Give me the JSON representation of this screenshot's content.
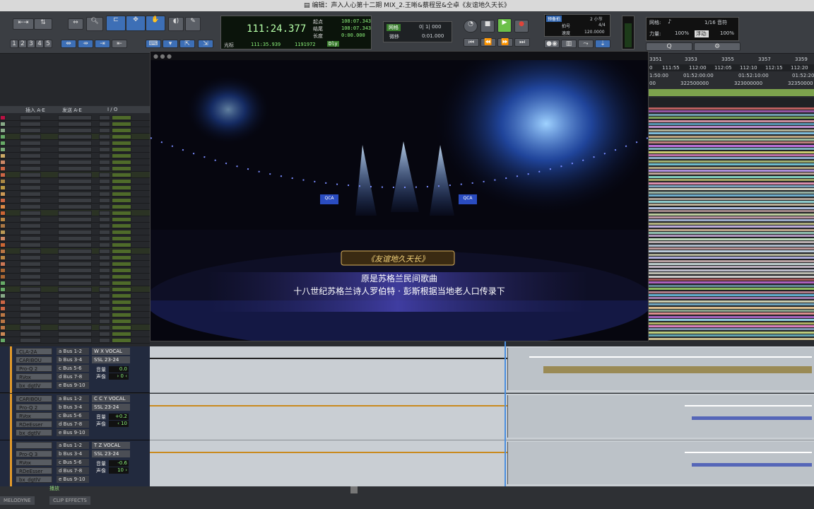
{
  "window": {
    "title": "编辑：声入人心第十二期 MIX_2.王晰&蔡程昱&仝卓《友谊地久天长》"
  },
  "toolbar": {
    "counter": {
      "main": "111:24.377",
      "start_label": "起点",
      "start_value": "108:07.343",
      "end_label": "结尾",
      "end_value": "108:07.343",
      "length_label": "长度",
      "length_value": "0:00.000",
      "cursor_label": "光标",
      "cursor_value": "111:35.939",
      "cursor_samples": "1191972",
      "dly": "Dly"
    },
    "numbers": [
      "1",
      "2",
      "3",
      "4",
      "5"
    ],
    "grid": {
      "label": "网格",
      "value": "0| 1| 000",
      "nudge_label": "微移",
      "nudge_value": "0:01.000"
    },
    "meter": {
      "preroll": "预备拍",
      "bars": "2 小节",
      "beat_label": "拍号",
      "beat_value": "4/4",
      "tempo_label": "速度",
      "tempo_value": "120.0000"
    },
    "grid2": {
      "label": "网格:",
      "value": "1/16 音符",
      "velocity_label": "力量:",
      "velocity_value": "100%",
      "float_label": "浮动:",
      "float_value": "100%"
    }
  },
  "ruler": {
    "bars": [
      "3351",
      "3353",
      "3355",
      "3357",
      "3359"
    ],
    "times": [
      "112:00",
      "112:05",
      "112:10",
      "112:15",
      "112:20"
    ],
    "times_prefix": [
      "0",
      "111:55"
    ],
    "min": [
      "1:50:00",
      "01:52:00:00",
      "01:52:10:00",
      "01:52:20"
    ],
    "samples": [
      "00",
      "322500000",
      "323000000",
      "32350000"
    ],
    "marker": "B 1"
  },
  "mix_header": {
    "inserts": "插入 A-E",
    "sends": "发送 A-E",
    "io": "I / O"
  },
  "video_overlay": {
    "badge_left": "QCA",
    "badge_right": "QCA",
    "title_plate": "《友谊地久天长》",
    "sub1": "原是苏格兰民间歌曲",
    "sub2": "十八世纪苏格兰诗人罗伯特 · 彭斯根据当地老人口传录下"
  },
  "tracks": [
    {
      "plugins": [
        "CLA-2A",
        "CARIBOU",
        "Pro-Q 2",
        "RVox",
        "bx_dgtlV"
      ],
      "buses": [
        "a  Bus 1-2",
        "b  Bus 3-4",
        "c  Bus 5-6",
        "d  Bus 7-8",
        "e  Bus 9-10"
      ],
      "name": "W X VOCAL",
      "out": "SSL 23-24",
      "vol_label": "音量",
      "vol": "0.0",
      "pan_label": "声像",
      "pan": "› 0 ‹"
    },
    {
      "plugins": [
        "CARIBOU",
        "Pro-Q 2",
        "RVox",
        "RDeEsser",
        "bx_dgtlV"
      ],
      "buses": [
        "a  Bus 1-2",
        "b  Bus 3-4",
        "c  Bus 5-6",
        "d  Bus 7-8",
        "e  Bus 9-10"
      ],
      "name": "C C Y VOCAL",
      "out": "SSL 23-24",
      "vol_label": "音量",
      "vol": "+0.2",
      "pan_label": "声像",
      "pan": "‹ 10"
    },
    {
      "plugins": [
        "",
        "Pro-Q 3",
        "RVox",
        "RDeEsser",
        "bx_dgtlV"
      ],
      "buses": [
        "a  Bus 1-2",
        "b  Bus 3-4",
        "c  Bus 5-6",
        "d  Bus 7-8",
        "e  Bus 9-10"
      ],
      "name": "T Z VOCAL",
      "out": "SSL 23-24",
      "vol_label": "音量",
      "vol": "-0.6",
      "pan_label": "声像",
      "pan": "10 ›"
    }
  ],
  "bottom": {
    "play": "播放",
    "tab1": "MELODYNE",
    "tab2": "CLIP EFFECTS"
  },
  "colors": {
    "accent": "#3d6fb6",
    "lcd": "#8bf07a",
    "play": "#6cc04a"
  }
}
